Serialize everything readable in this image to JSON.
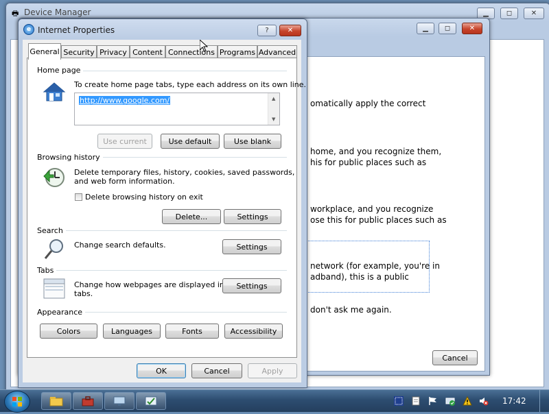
{
  "device_manager": {
    "title": "Device Manager"
  },
  "network_dialog": {
    "body_lines": [
      "omatically apply the correct",
      "home, and you recognize them,",
      "his for public places such as",
      "workplace, and you recognize",
      "ose this for public places such as",
      "network (for example, you're in",
      "adband), this is a public",
      "don't ask me again."
    ],
    "cancel_label": "Cancel"
  },
  "dialog": {
    "title": "Internet Properties",
    "help_glyph": "?",
    "close_glyph": "✕",
    "tabs": [
      "General",
      "Security",
      "Privacy",
      "Content",
      "Connections",
      "Programs",
      "Advanced"
    ],
    "home_page": {
      "label": "Home page",
      "instruction": "To create home page tabs, type each address on its own line.",
      "url": "http://www.google.com/",
      "use_current": "Use current",
      "use_default": "Use default",
      "use_blank": "Use blank"
    },
    "browsing_history": {
      "label": "Browsing history",
      "description_line1": "Delete temporary files, history, cookies, saved passwords,",
      "description_line2": "and web form information.",
      "checkbox_label": "Delete browsing history on exit",
      "delete_button": "Delete...",
      "settings_button": "Settings"
    },
    "search": {
      "label": "Search",
      "description": "Change search defaults.",
      "settings_button": "Settings"
    },
    "tabs_section": {
      "label": "Tabs",
      "description_line1": "Change how webpages are displayed in",
      "description_line2": "tabs.",
      "settings_button": "Settings"
    },
    "appearance": {
      "label": "Appearance",
      "buttons": [
        "Colors",
        "Languages",
        "Fonts",
        "Accessibility"
      ]
    },
    "footer": {
      "ok": "OK",
      "cancel": "Cancel",
      "apply": "Apply"
    }
  },
  "taskbar": {
    "clock": "17:42",
    "pinned": [
      "file-explorer-icon",
      "toolbox-icon",
      "network-monitor-icon",
      "control-panel-icon"
    ],
    "tray": [
      "keyboard-layout-icon",
      "document-icon",
      "action-center-flag-icon",
      "network-check-icon",
      "warning-icon",
      "volume-muted-icon"
    ]
  }
}
